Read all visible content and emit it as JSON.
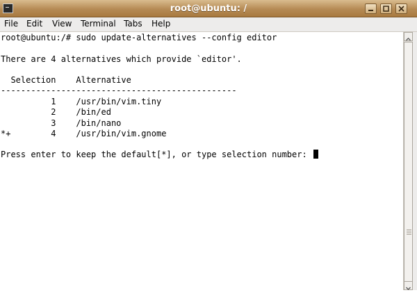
{
  "window": {
    "title": "root@ubuntu: /"
  },
  "menubar": {
    "items": [
      {
        "label": "File"
      },
      {
        "label": "Edit"
      },
      {
        "label": "View"
      },
      {
        "label": "Terminal"
      },
      {
        "label": "Tabs"
      },
      {
        "label": "Help"
      }
    ]
  },
  "terminal": {
    "lines": [
      "root@ubuntu:/# sudo update-alternatives --config editor",
      "",
      "There are 4 alternatives which provide `editor'.",
      "",
      "  Selection    Alternative",
      "-----------------------------------------------",
      "          1    /usr/bin/vim.tiny",
      "          2    /bin/ed",
      "          3    /bin/nano",
      "*+        4    /usr/bin/vim.gnome",
      "",
      "Press enter to keep the default[*], or type selection number: "
    ]
  },
  "icons": {
    "app": "terminal-icon",
    "minimize": "minimize-icon",
    "maximize": "maximize-icon",
    "close": "close-icon"
  },
  "colors": {
    "titlebar": "#b58a54",
    "menubar": "#edeceb",
    "terminal_bg": "#ffffff",
    "terminal_fg": "#000000"
  }
}
